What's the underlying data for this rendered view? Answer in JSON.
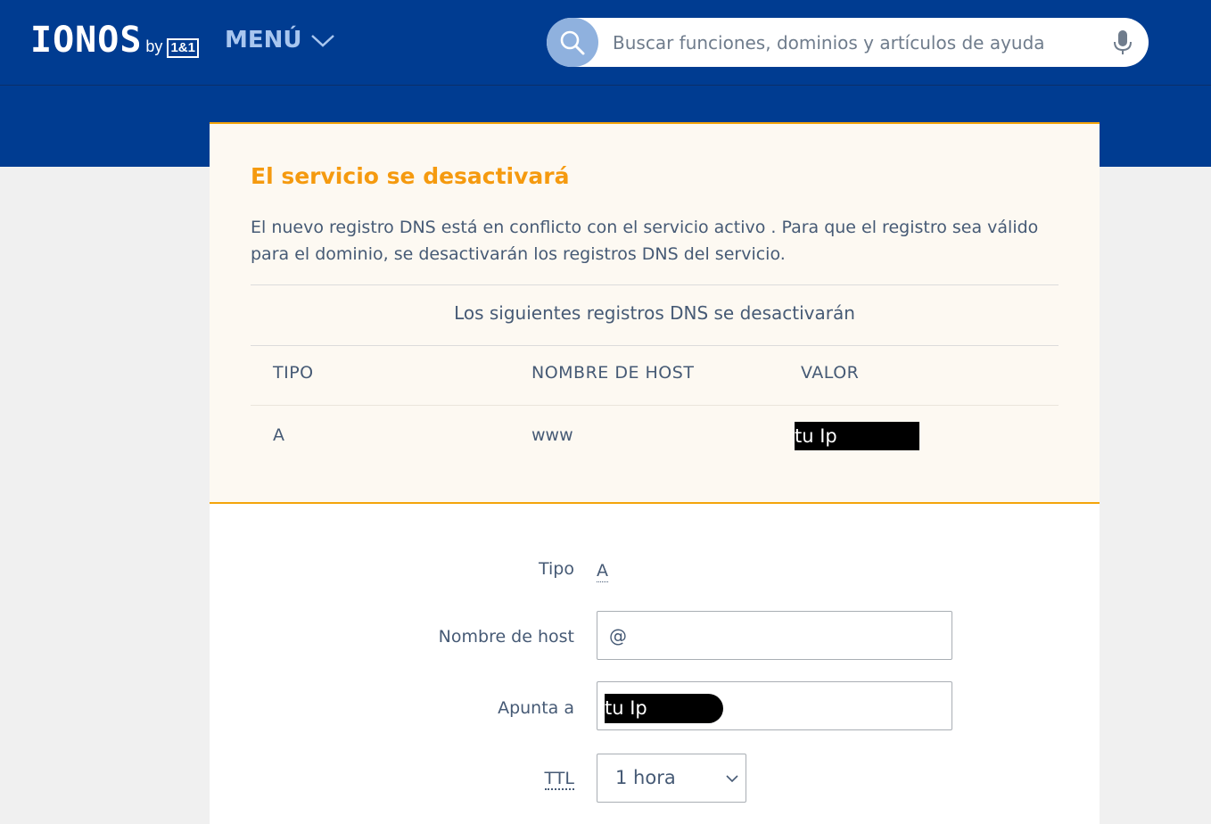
{
  "header": {
    "logo_text": "IONOS",
    "logo_by": "by",
    "logo_partner": "1&1",
    "menu_label": "MENÚ",
    "search_placeholder": "Buscar funciones, dominios y artículos de ayuda"
  },
  "warning": {
    "title": "El servicio se desactivará",
    "text": "El nuevo registro DNS está en conflicto con el servicio activo . Para que el registro sea válido para el dominio, se desactivarán los registros DNS del servicio.",
    "subheading": "Los siguientes registros DNS se desactivarán",
    "columns": [
      "TIPO",
      "NOMBRE DE HOST",
      "VALOR"
    ],
    "rows": [
      {
        "tipo": "A",
        "host": "www",
        "valor": "tu Ip"
      }
    ]
  },
  "form": {
    "tipo_label": "Tipo",
    "tipo_value": "A",
    "host_label": "Nombre de host",
    "host_value": "@",
    "points_label": "Apunta a",
    "points_value": "tu Ip",
    "ttl_label": "TTL",
    "ttl_value": "1 hora"
  },
  "colors": {
    "brand_blue": "#003c91",
    "accent_orange": "#f59a0f"
  },
  "icons": {
    "search": "search-icon",
    "mic": "microphone-icon",
    "menu_chevron": "chevron-down-icon",
    "select_chevron": "chevron-down-icon"
  }
}
